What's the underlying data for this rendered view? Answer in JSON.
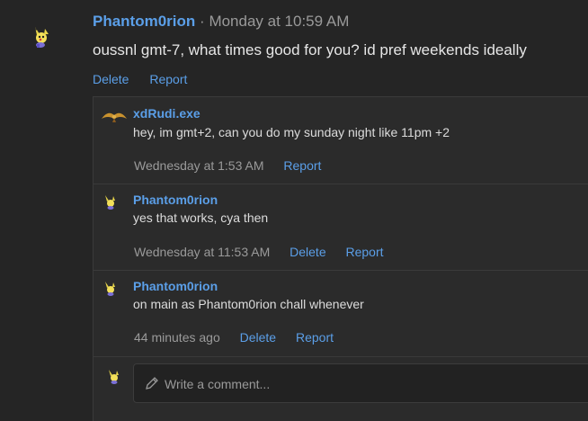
{
  "post": {
    "author": "Phantom0rion",
    "separator": "·",
    "time": "Monday at 10:59 AM",
    "body": "oussnl gmt-7, what times good for you? id pref weekends ideally",
    "actions": [
      "Delete",
      "Report"
    ]
  },
  "comments": [
    {
      "author": "xdRudi.exe",
      "text": "hey, im gmt+2, can you do my sunday night like 11pm +2",
      "time": "Wednesday at 1:53 AM",
      "actions": [
        "Report"
      ]
    },
    {
      "author": "Phantom0rion",
      "text": "yes that works, cya then",
      "time": "Wednesday at 11:53 AM",
      "actions": [
        "Delete",
        "Report"
      ]
    },
    {
      "author": "Phantom0rion",
      "text": "on main as Phantom0rion chall whenever",
      "time": "44 minutes ago",
      "actions": [
        "Delete",
        "Report"
      ]
    }
  ],
  "reply": {
    "placeholder": "Write a comment..."
  },
  "colors": {
    "background": "#252525",
    "link": "#5b9fe8",
    "muted": "#9a9a9a"
  },
  "icons": {
    "post_avatar": "pikachu-avatar-icon",
    "rudi_avatar": "bird-avatar-icon",
    "pencil": "pencil-icon"
  }
}
